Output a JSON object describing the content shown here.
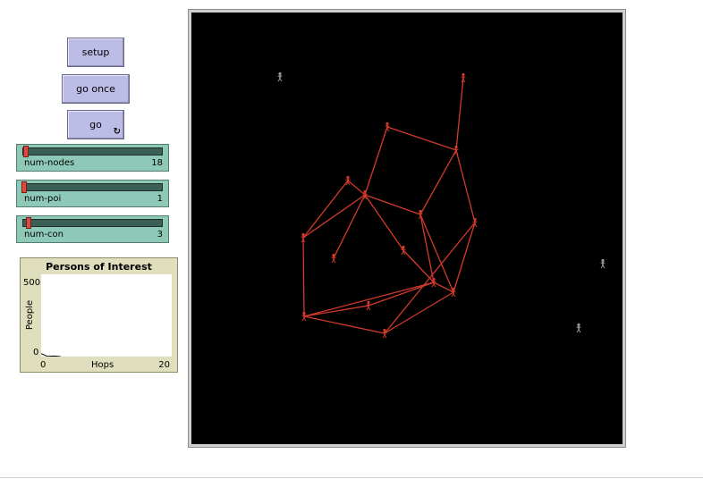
{
  "buttons": {
    "setup": "setup",
    "go_once": "go once",
    "go": "go",
    "go_forever_icon": "↻"
  },
  "sliders": [
    {
      "name": "num-nodes",
      "value": "18",
      "level": 0.0
    },
    {
      "name": "num-poi",
      "value": "1",
      "level": 0.0
    },
    {
      "name": "num-con",
      "value": "3",
      "level": 0.0
    }
  ],
  "plot": {
    "title": "Persons of Interest",
    "ylabel": "People",
    "xlabel": "Hops",
    "ymax": "500",
    "ymin": "0",
    "xmin": "0",
    "xmax": "20"
  },
  "chart_data": {
    "type": "line",
    "title": "Persons of Interest",
    "xlabel": "Hops",
    "ylabel": "People",
    "xlim": [
      0,
      20
    ],
    "ylim": [
      0,
      500
    ],
    "x": [
      0,
      1,
      2,
      3
    ],
    "values": [
      18,
      1,
      3,
      0
    ]
  },
  "colors": {
    "network": "#d23a2b",
    "isolated": "#9a9a9a",
    "world_bg": "#000000"
  },
  "icons": {
    "agent": "person-icon"
  }
}
